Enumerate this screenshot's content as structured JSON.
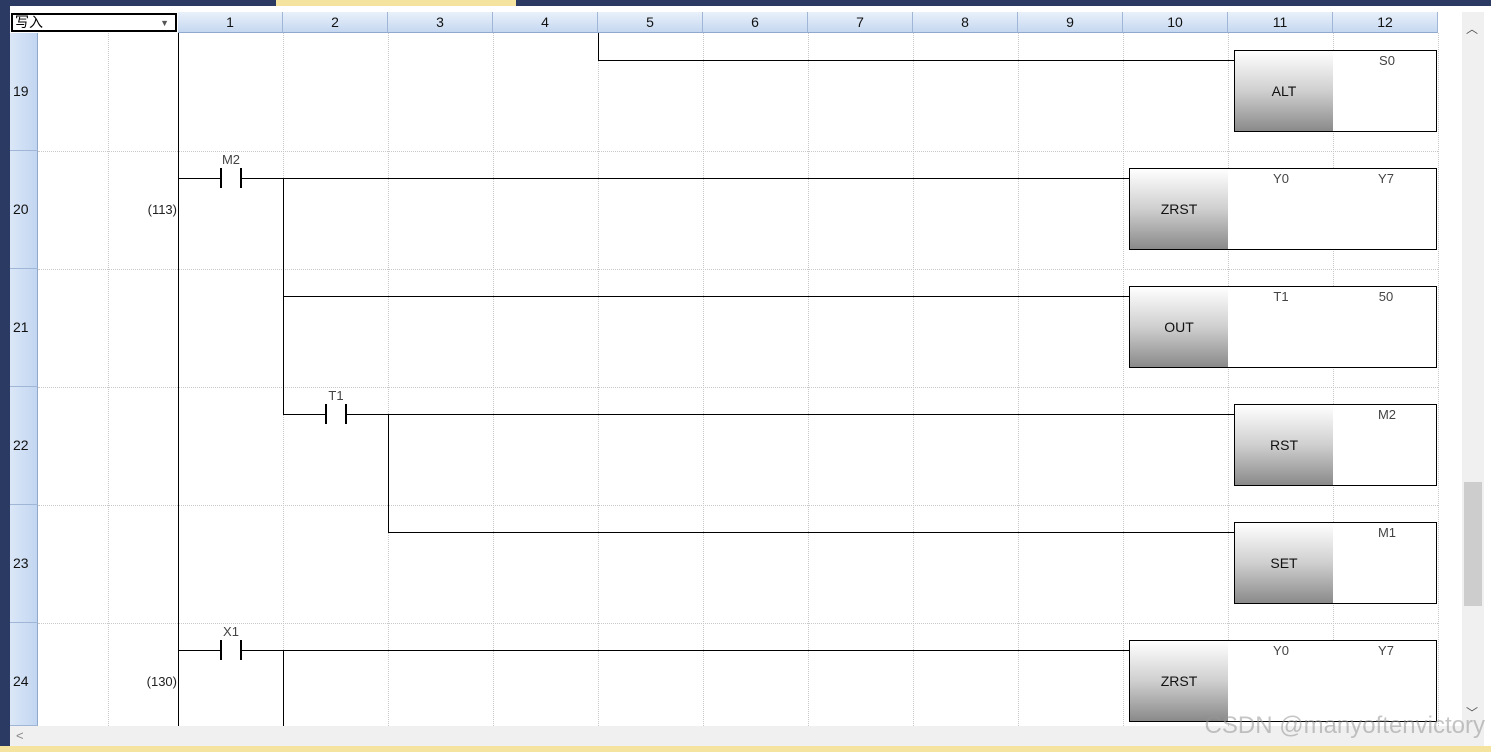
{
  "toolbar": {
    "mode_value": "写入"
  },
  "columns": [
    "1",
    "2",
    "3",
    "4",
    "5",
    "6",
    "7",
    "8",
    "9",
    "10",
    "11",
    "12"
  ],
  "rows": [
    "19",
    "20",
    "21",
    "22",
    "23",
    "24"
  ],
  "steps": {
    "row20": "(113)",
    "row24": "(130)"
  },
  "contacts": {
    "c20": "M2",
    "c22": "T1",
    "c24": "X1"
  },
  "instructions": {
    "r19": {
      "op": "ALT",
      "a1": "S0"
    },
    "r20": {
      "op": "ZRST",
      "a1": "Y0",
      "a2": "Y7"
    },
    "r21": {
      "op": "OUT",
      "a1": "T1",
      "a2": "50"
    },
    "r22": {
      "op": "RST",
      "a1": "M2"
    },
    "r23": {
      "op": "SET",
      "a1": "M1"
    },
    "r24": {
      "op": "ZRST",
      "a1": "Y0",
      "a2": "Y7"
    }
  },
  "watermark": "CSDN @manyoftenvictory",
  "colors": {
    "header_blue": "#c5d8f0",
    "frame": "#2b3a63",
    "accent_yellow": "#f5e3a0"
  }
}
